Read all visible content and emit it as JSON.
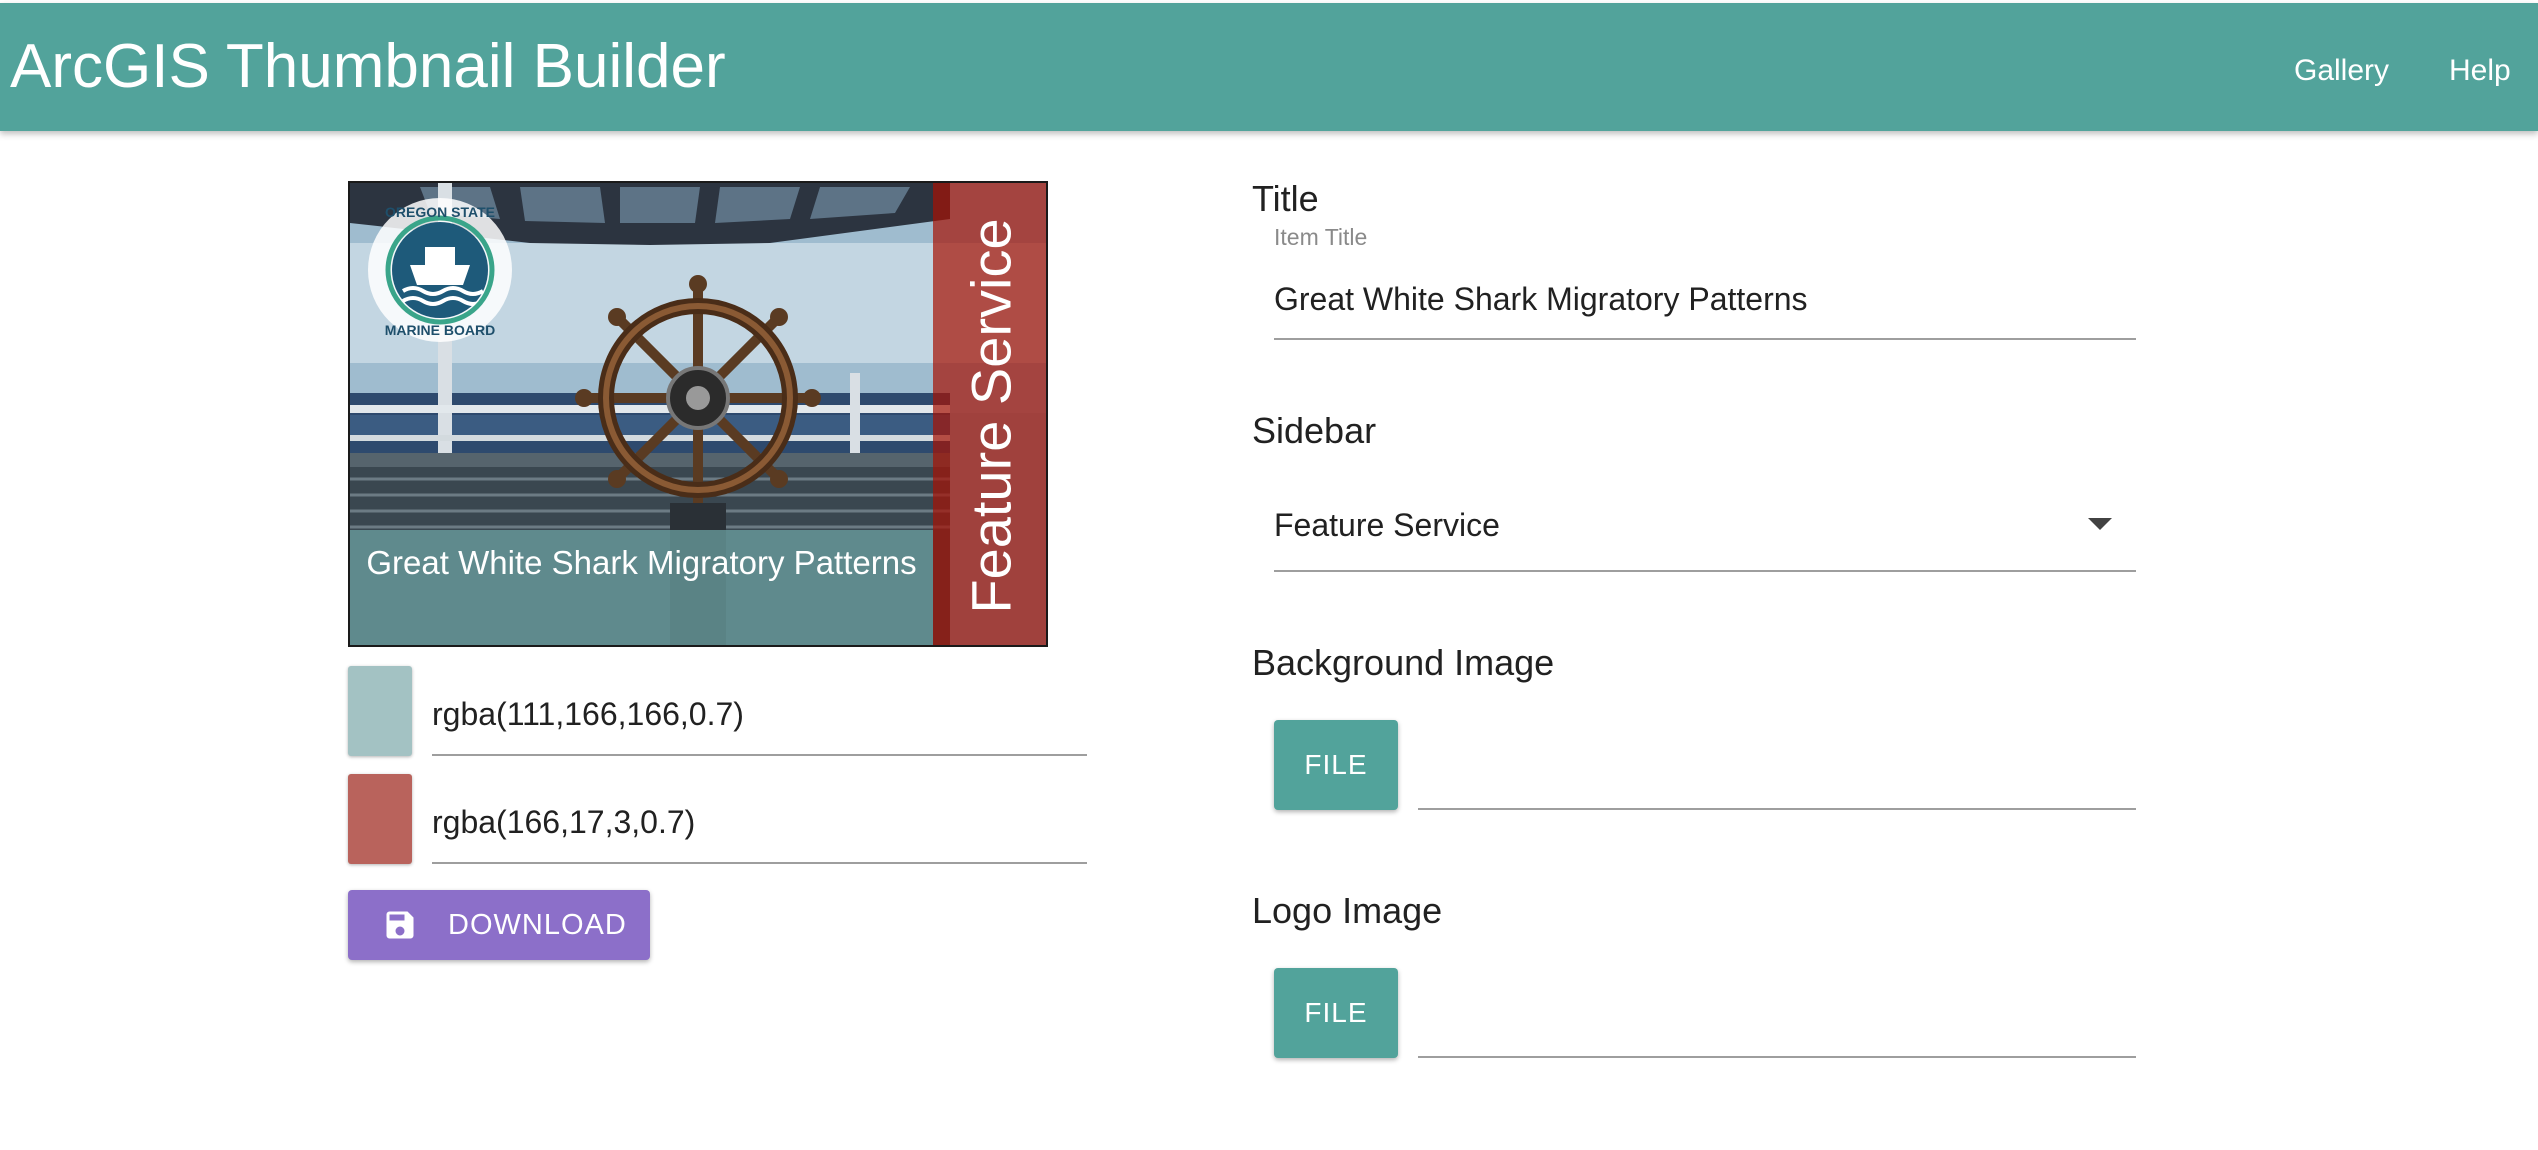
{
  "app": {
    "title": "ArcGIS Thumbnail Builder",
    "nav": [
      {
        "label": "Gallery"
      },
      {
        "label": "Help"
      }
    ]
  },
  "preview": {
    "caption": "Great White Shark Migratory Patterns",
    "sidebar_text": "Feature Service",
    "logo_text": "OREGON STATE MARINE BOARD"
  },
  "colors": [
    {
      "value": "rgba(111,166,166,0.7)",
      "swatch": "#a3c2c3"
    },
    {
      "value": "rgba(166,17,3,0.7)",
      "swatch": "#b9635c"
    }
  ],
  "download": {
    "label": "DOWNLOAD",
    "icon": "save-icon"
  },
  "form": {
    "title": {
      "heading": "Title",
      "float_label": "Item Title",
      "value": "Great White Shark Migratory Patterns"
    },
    "sidebar": {
      "heading": "Sidebar",
      "value": "Feature Service",
      "icon": "dropdown-arrow-icon"
    },
    "background_image": {
      "heading": "Background Image",
      "button": "FILE"
    },
    "logo_image": {
      "heading": "Logo Image",
      "button": "FILE"
    }
  },
  "theme": {
    "primary": "#52a39b",
    "accent": "#8c6fc9"
  }
}
